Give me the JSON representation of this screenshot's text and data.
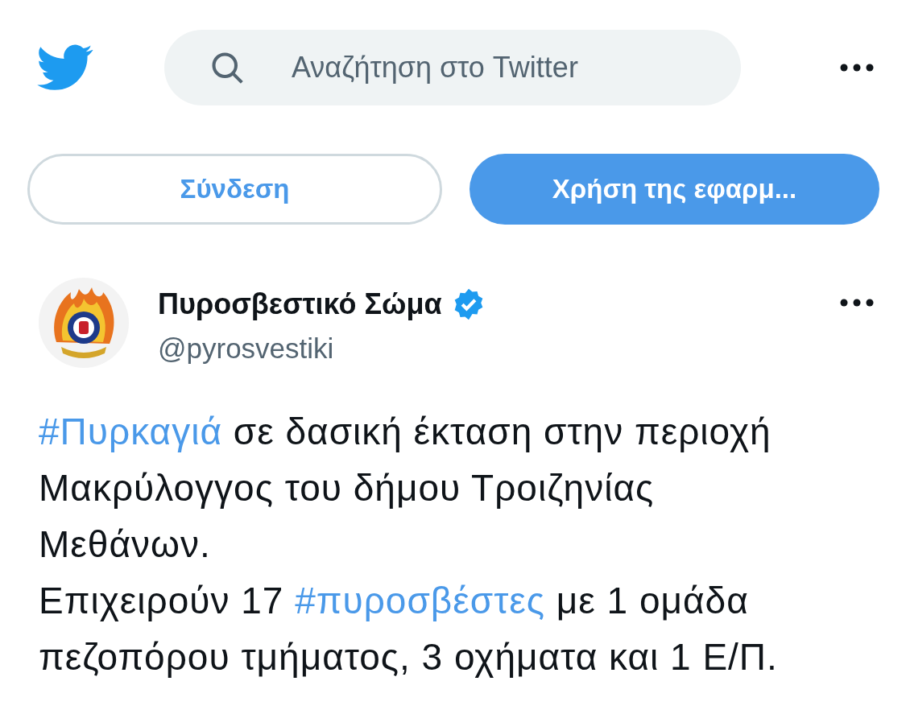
{
  "search": {
    "placeholder": "Αναζήτηση στο Twitter"
  },
  "buttons": [
    {
      "label": "Σύνδεση",
      "kind": "outline"
    },
    {
      "label": "Χρήση της εφαρμ...",
      "kind": "filled"
    }
  ],
  "tweet": {
    "name": "Πυροσβεστικό Σώμα",
    "verified": true,
    "handle": "@pyrosvestiki",
    "paragraphs": [
      [
        {
          "kind": "hashtag",
          "text": "#Πυρκαγιά"
        },
        {
          "kind": "text",
          "text": " σε δασική έκταση στην περιοχή Μακρύλογγος του δήμου Τροιζηνίας Μεθάνων."
        }
      ],
      [
        {
          "kind": "text",
          "text": "Επιχειρούν 17 "
        },
        {
          "kind": "hashtag",
          "text": "#πυροσβέστες"
        },
        {
          "kind": "text",
          "text": " με 1 ομάδα πεζοπόρου τμήματος, 3 οχήματα και 1 Ε/Π."
        }
      ]
    ]
  }
}
